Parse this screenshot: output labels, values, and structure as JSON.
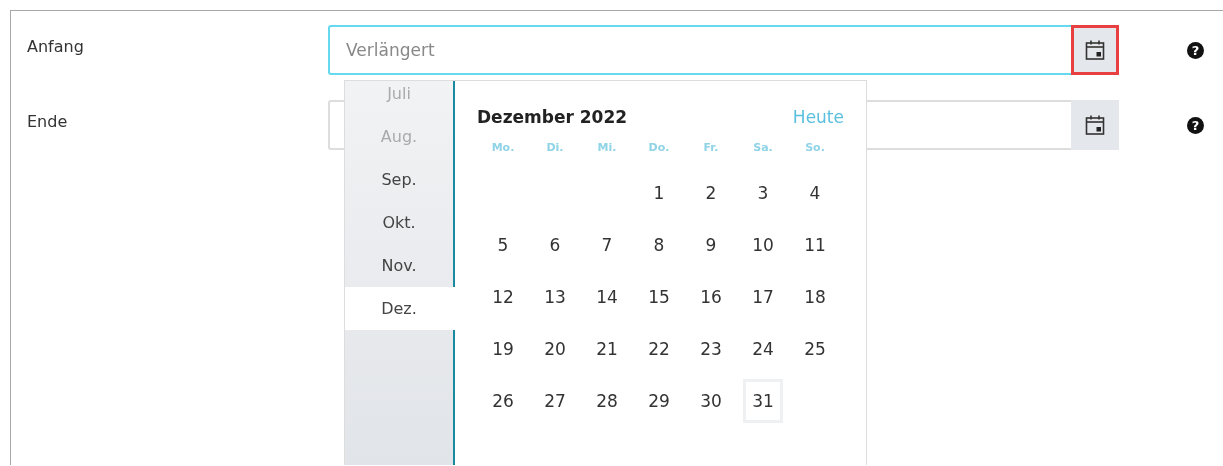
{
  "fields": [
    {
      "label": "Anfang",
      "placeholder": "Verlängert",
      "focused": true,
      "button_highlighted": true,
      "help": "?"
    },
    {
      "label": "Ende",
      "focused": false,
      "button_highlighted": false,
      "help": "?"
    }
  ],
  "datepicker": {
    "months": [
      {
        "label": "Juli",
        "selected": false,
        "dimmed": true
      },
      {
        "label": "Aug.",
        "selected": false,
        "dimmed": true
      },
      {
        "label": "Sep.",
        "selected": false,
        "dimmed": false
      },
      {
        "label": "Okt.",
        "selected": false,
        "dimmed": false
      },
      {
        "label": "Nov.",
        "selected": false,
        "dimmed": false
      },
      {
        "label": "Dez.",
        "selected": true,
        "dimmed": false
      }
    ],
    "title": "Dezember 2022",
    "today_link": "Heute",
    "weekdays": [
      "Mo.",
      "Di.",
      "Mi.",
      "Do.",
      "Fr.",
      "Sa.",
      "So."
    ],
    "weeks": [
      [
        {
          "kind": "blank"
        },
        {
          "kind": "blank"
        },
        {
          "kind": "blank"
        },
        {
          "kind": "day",
          "day": "1",
          "today": false
        },
        {
          "kind": "day",
          "day": "2",
          "today": false
        },
        {
          "kind": "day",
          "day": "3",
          "today": false
        },
        {
          "kind": "day",
          "day": "4",
          "today": false
        }
      ],
      [
        {
          "kind": "day",
          "day": "5",
          "today": false
        },
        {
          "kind": "day",
          "day": "6",
          "today": false
        },
        {
          "kind": "day",
          "day": "7",
          "today": false
        },
        {
          "kind": "day",
          "day": "8",
          "today": false
        },
        {
          "kind": "day",
          "day": "9",
          "today": false
        },
        {
          "kind": "day",
          "day": "10",
          "today": false
        },
        {
          "kind": "day",
          "day": "11",
          "today": false
        }
      ],
      [
        {
          "kind": "day",
          "day": "12",
          "today": false
        },
        {
          "kind": "day",
          "day": "13",
          "today": false
        },
        {
          "kind": "day",
          "day": "14",
          "today": false
        },
        {
          "kind": "day",
          "day": "15",
          "today": false
        },
        {
          "kind": "day",
          "day": "16",
          "today": false
        },
        {
          "kind": "day",
          "day": "17",
          "today": false
        },
        {
          "kind": "day",
          "day": "18",
          "today": false
        }
      ],
      [
        {
          "kind": "day",
          "day": "19",
          "today": false
        },
        {
          "kind": "day",
          "day": "20",
          "today": false
        },
        {
          "kind": "day",
          "day": "21",
          "today": false
        },
        {
          "kind": "day",
          "day": "22",
          "today": false
        },
        {
          "kind": "day",
          "day": "23",
          "today": false
        },
        {
          "kind": "day",
          "day": "24",
          "today": false
        },
        {
          "kind": "day",
          "day": "25",
          "today": false
        }
      ],
      [
        {
          "kind": "day",
          "day": "26",
          "today": false
        },
        {
          "kind": "day",
          "day": "27",
          "today": false
        },
        {
          "kind": "day",
          "day": "28",
          "today": false
        },
        {
          "kind": "day",
          "day": "29",
          "today": false
        },
        {
          "kind": "day",
          "day": "30",
          "today": false
        },
        {
          "kind": "day",
          "day": "31",
          "today": true
        }
      ]
    ]
  }
}
